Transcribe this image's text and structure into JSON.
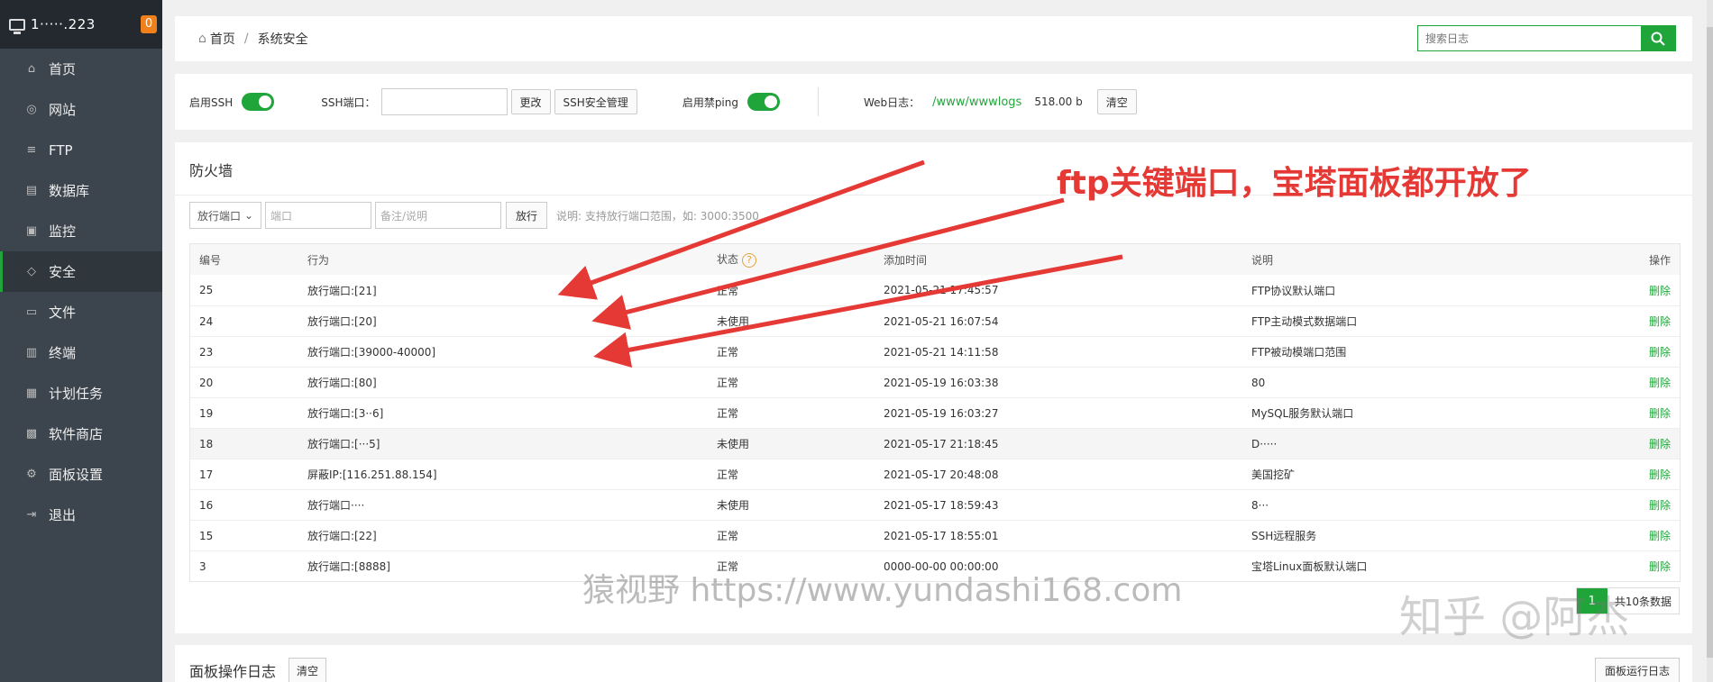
{
  "sidebar": {
    "hostname": "1·····.223",
    "badge": "0",
    "items": [
      {
        "label": "首页",
        "icon": "home-icon"
      },
      {
        "label": "网站",
        "icon": "globe-icon"
      },
      {
        "label": "FTP",
        "icon": "ftp-icon"
      },
      {
        "label": "数据库",
        "icon": "database-icon"
      },
      {
        "label": "监控",
        "icon": "monitor-icon"
      },
      {
        "label": "安全",
        "icon": "shield-icon"
      },
      {
        "label": "文件",
        "icon": "folder-icon"
      },
      {
        "label": "终端",
        "icon": "terminal-icon"
      },
      {
        "label": "计划任务",
        "icon": "calendar-icon"
      },
      {
        "label": "软件商店",
        "icon": "apps-icon"
      },
      {
        "label": "面板设置",
        "icon": "gear-icon"
      },
      {
        "label": "退出",
        "icon": "logout-icon"
      }
    ]
  },
  "breadcrumb": {
    "home": "首页",
    "sep": "/",
    "current": "系统安全"
  },
  "search": {
    "placeholder": "搜索日志"
  },
  "toolbar": {
    "ssh_label": "启用SSH",
    "ssh_port_label": "SSH端口：",
    "change_btn": "更改",
    "ssh_manage_btn": "SSH安全管理",
    "ping_label": "启用禁ping",
    "web_log_label": "Web日志：",
    "web_log_path": "/www/wwwlogs",
    "web_log_size": "518.00 b",
    "clear_btn": "清空"
  },
  "firewall": {
    "title": "防火墙",
    "select_value": "放行端口",
    "port_placeholder": "端口",
    "note_placeholder": "备注/说明",
    "allow_btn": "放行",
    "hint": "说明: 支持放行端口范围，如: 3000:3500",
    "headers": [
      "编号",
      "行为",
      "状态",
      "添加时间",
      "说明",
      "操作"
    ],
    "rows": [
      {
        "id": "25",
        "action": "放行端口:[21]",
        "status": "正常",
        "time": "2021-05-21 17:45:57",
        "note": "FTP协议默认端口",
        "op": "删除"
      },
      {
        "id": "24",
        "action": "放行端口:[20]",
        "status": "未使用",
        "time": "2021-05-21 16:07:54",
        "note": "FTP主动模式数据端口",
        "op": "删除"
      },
      {
        "id": "23",
        "action": "放行端口:[39000-40000]",
        "status": "正常",
        "time": "2021-05-21 14:11:58",
        "note": "FTP被动模端口范围",
        "op": "删除"
      },
      {
        "id": "20",
        "action": "放行端口:[80]",
        "status": "正常",
        "time": "2021-05-19 16:03:38",
        "note": "80",
        "op": "删除"
      },
      {
        "id": "19",
        "action": "放行端口:[3··6]",
        "status": "正常",
        "time": "2021-05-19 16:03:27",
        "note": "MySQL服务默认端口",
        "op": "删除"
      },
      {
        "id": "18",
        "action": "放行端口:[···5]",
        "status": "未使用",
        "time": "2021-05-17 21:18:45",
        "note": "D·····",
        "op": "删除"
      },
      {
        "id": "17",
        "action": "屏蔽IP:[116.251.88.154]",
        "status": "正常",
        "time": "2021-05-17 20:48:08",
        "note": "美国挖矿",
        "op": "删除"
      },
      {
        "id": "16",
        "action": "放行端口····",
        "status": "未使用",
        "time": "2021-05-17 18:59:43",
        "note": "8···",
        "op": "删除"
      },
      {
        "id": "15",
        "action": "放行端口:[22]",
        "status": "正常",
        "time": "2021-05-17 18:55:01",
        "note": "SSH远程服务",
        "op": "删除"
      },
      {
        "id": "3",
        "action": "放行端口:[8888]",
        "status": "正常",
        "time": "0000-00-00 00:00:00",
        "note": "宝塔Linux面板默认端口",
        "op": "删除"
      }
    ],
    "page_num": "1",
    "total_text": "共10条数据"
  },
  "log": {
    "title": "面板操作日志",
    "clear_btn": "清空",
    "run_btn": "面板运行日志"
  },
  "annotation": "ftp关键端口，宝塔面板都开放了",
  "watermarks": {
    "site": "猿视野 https://www.yundashi168.com",
    "zhihu": "知乎 @阿杰"
  },
  "colors": {
    "accent": "#20a53a",
    "sidebar": "#3c444d",
    "annotation": "#e53935"
  }
}
